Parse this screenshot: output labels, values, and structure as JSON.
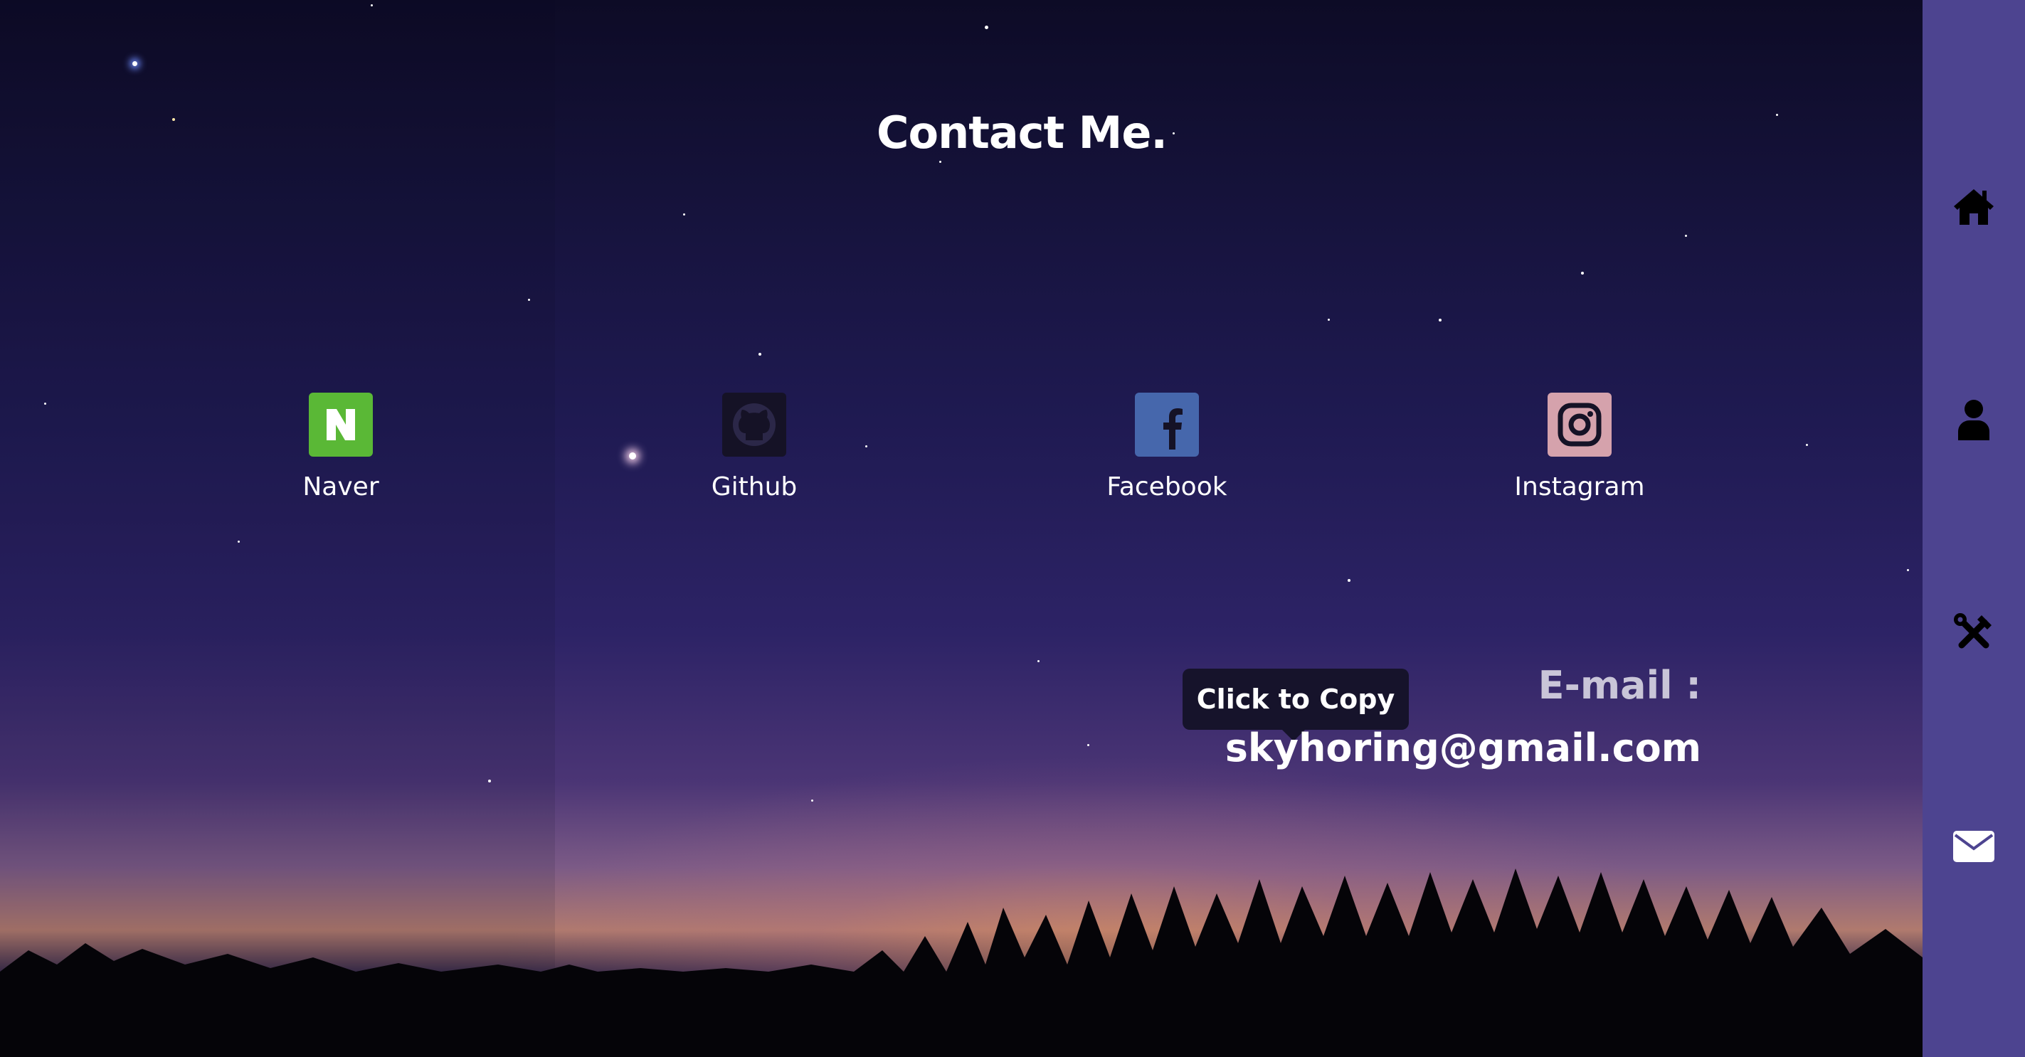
{
  "page": {
    "title": "Contact Me."
  },
  "contacts": [
    {
      "name": "Naver",
      "icon": "naver-icon",
      "color": "#5ab836"
    },
    {
      "name": "Github",
      "icon": "github-icon",
      "color": "#151226"
    },
    {
      "name": "Facebook",
      "icon": "facebook-icon",
      "color": "#4667ac"
    },
    {
      "name": "Instagram",
      "icon": "instagram-icon",
      "color": "#d5a2ac"
    }
  ],
  "email": {
    "label": "E-mail :",
    "address": "skyhoring@gmail.com",
    "tooltip": "Click to Copy"
  },
  "sidebar": {
    "background": "#4d4490",
    "items": [
      {
        "icon": "home-icon"
      },
      {
        "icon": "user-icon"
      },
      {
        "icon": "tools-icon"
      },
      {
        "icon": "envelope-icon"
      }
    ]
  }
}
